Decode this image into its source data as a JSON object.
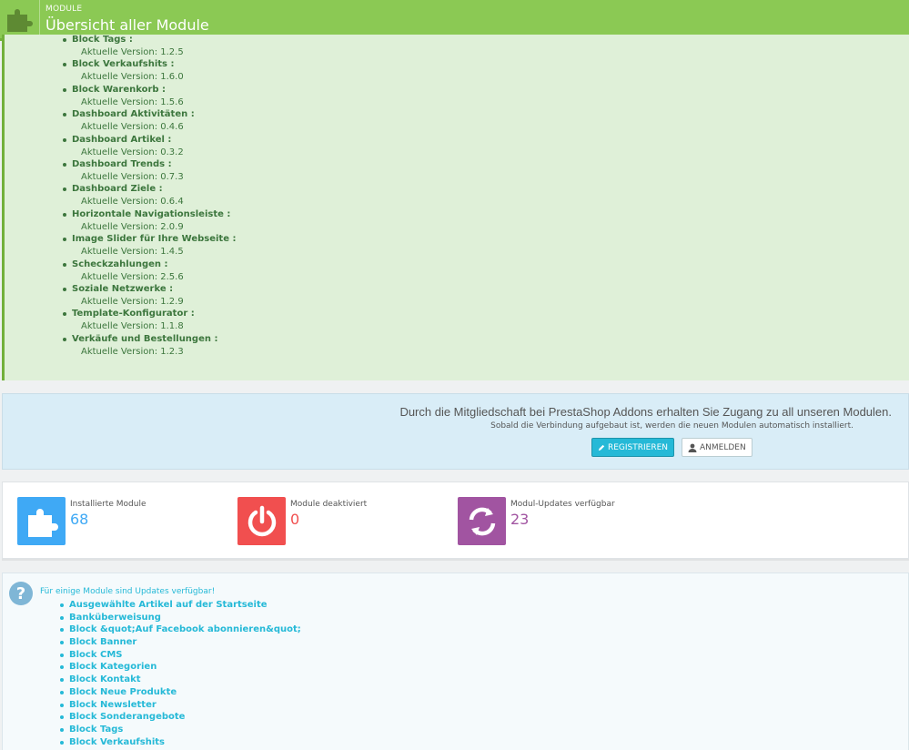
{
  "header": {
    "breadcrumb": "MODULE",
    "title": "Übersicht aller Module",
    "brand_color": "#8bc954"
  },
  "installed_list": {
    "version_prefix": "Aktuelle Version:",
    "items": [
      {
        "name": "Block Tags :",
        "version": "Aktuelle Version: 1.2.5"
      },
      {
        "name": "Block Verkaufshits :",
        "version": "Aktuelle Version: 1.6.0"
      },
      {
        "name": "Block Warenkorb :",
        "version": "Aktuelle Version: 1.5.6"
      },
      {
        "name": "Dashboard Aktivitäten :",
        "version": "Aktuelle Version: 0.4.6"
      },
      {
        "name": "Dashboard Artikel :",
        "version": "Aktuelle Version: 0.3.2"
      },
      {
        "name": "Dashboard Trends :",
        "version": "Aktuelle Version: 0.7.3"
      },
      {
        "name": "Dashboard Ziele :",
        "version": "Aktuelle Version: 0.6.4"
      },
      {
        "name": "Horizontale Navigationsleiste :",
        "version": "Aktuelle Version: 2.0.9"
      },
      {
        "name": "Image Slider für Ihre Webseite :",
        "version": "Aktuelle Version: 1.4.5"
      },
      {
        "name": "Scheckzahlungen :",
        "version": "Aktuelle Version: 2.5.6"
      },
      {
        "name": "Soziale Netzwerke :",
        "version": "Aktuelle Version: 1.2.9"
      },
      {
        "name": "Template-Konfigurator :",
        "version": "Aktuelle Version: 1.1.8"
      },
      {
        "name": "Verkäufe und Bestellungen :",
        "version": "Aktuelle Version: 1.2.3"
      }
    ]
  },
  "addons": {
    "lead": "Durch die Mitgliedschaft bei PrestaShop Addons erhalten Sie Zugang zu all unseren Modulen.",
    "sub": "Sobald die Verbindung aufgebaut ist, werden die neuen Modulen automatisch installiert.",
    "register_label": "REGISTRIEREN",
    "login_label": "ANMELDEN"
  },
  "kpis": [
    {
      "label": "Installierte Module",
      "value": "68",
      "color": "#3fa9f5",
      "icon": "puzzle-icon"
    },
    {
      "label": "Module deaktiviert",
      "value": "0",
      "color": "#f14f4f",
      "icon": "power-icon"
    },
    {
      "label": "Modul-Updates verfügbar",
      "value": "23",
      "color": "#a154a1",
      "icon": "refresh-icon"
    }
  ],
  "updates": {
    "title": "Für einige Module sind Updates verfügbar!",
    "items": [
      "Ausgewählte Artikel auf der Startseite",
      "Banküberweisung",
      "Block &quot;Auf Facebook abonnieren&quot;",
      "Block Banner",
      "Block CMS",
      "Block Kategorien",
      "Block Kontakt",
      "Block Neue Produkte",
      "Block Newsletter",
      "Block Sonderangebote",
      "Block Tags",
      "Block Verkaufshits"
    ]
  }
}
